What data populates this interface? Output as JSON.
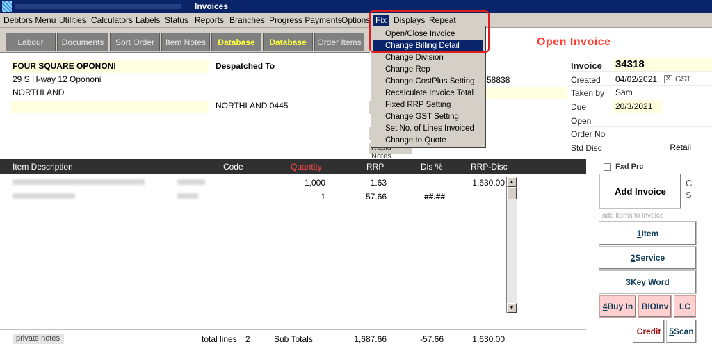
{
  "window": {
    "title": "Invoices"
  },
  "menubar": [
    "Debtors Menu",
    "Utilities",
    "Calculators",
    "Labels",
    "Status",
    "Reports",
    "Branches",
    "Progress Payments",
    "Options",
    "Fix",
    "Displays",
    "Repeat"
  ],
  "toolbar": [
    "Labour",
    "Documents",
    "Sort Order",
    "Item Notes",
    "Database",
    "Database",
    "Order Items"
  ],
  "status_heading": "Open Invoice",
  "billing": {
    "name": "FOUR SQUARE OPONONI",
    "address1": "29 S H-way 12 Opononi",
    "address2": "NORTHLAND"
  },
  "despatch": {
    "heading": "Despatched To",
    "region": "NORTHLAND 0445",
    "phone_fragment": "58838",
    "rapid_notes": "Rapid Notes"
  },
  "invoice": {
    "label": "Invoice",
    "number": "34318",
    "created_label": "Created",
    "created": "04/02/2021",
    "gst_label": "GST",
    "taken_label": "Taken by",
    "taken": "Sam",
    "due_label": "Due",
    "due": "20/3/2021",
    "open_label": "Open",
    "order_label": "Order No",
    "disc_label": "Std Disc",
    "disc": "Retail"
  },
  "fix_menu": {
    "items": [
      "Open/Close Invoice",
      "Change Billing Detail",
      "Change Division",
      "Change Rep",
      "Change CostPlus Setting",
      "Recalculate Invoice Total",
      "Fixed RRP Setting",
      "Change GST Setting",
      "Set No. of Lines Invoiced",
      "Change to Quote"
    ],
    "highlighted": "Change Billing Detail"
  },
  "grid": {
    "headers": {
      "desc": "Item Description",
      "code": "Code",
      "qty": "Quantity",
      "rrp": "RRP",
      "dis": "Dis %",
      "rrpdisc": "RRP-Disc"
    },
    "rows": [
      {
        "qty": "1,000",
        "rrp": "1.63",
        "dis": "",
        "rrpdisc": "1,630.00"
      },
      {
        "qty": "1",
        "rrp": "57.66",
        "dis": "##.##",
        "rrpdisc": ""
      }
    ]
  },
  "footer": {
    "private_notes": "private notes",
    "total_lines_label": "total lines",
    "total_lines": "2",
    "subtotals_label": "Sub Totals",
    "rrp_total": "1,687.66",
    "dis_total": "-57.66",
    "rrpdisc_total": "1,630.00"
  },
  "sidebar": {
    "fixed_price": "Fxd Prc",
    "add_invoice": "Add Invoice",
    "cs_c": "C",
    "cs_s": "S",
    "add_hint": "add items to invoice",
    "item": {
      "key": "1",
      "label": " Item"
    },
    "service": {
      "key": "2",
      "label": " Service"
    },
    "keyword": {
      "key": "3",
      "label": " Key Word"
    },
    "buyin": {
      "key": "4",
      "label": " Buy In"
    },
    "bioinv": "BIOInv",
    "lc": "LC",
    "credit": "Credit",
    "scan": {
      "key": "5",
      "label": " Scan"
    }
  },
  "colors": {
    "titlebar": "#0a246a",
    "accent_red": "#ff3b30",
    "highlight_yellow": "#ffffe0",
    "grid_header": "#303030"
  }
}
